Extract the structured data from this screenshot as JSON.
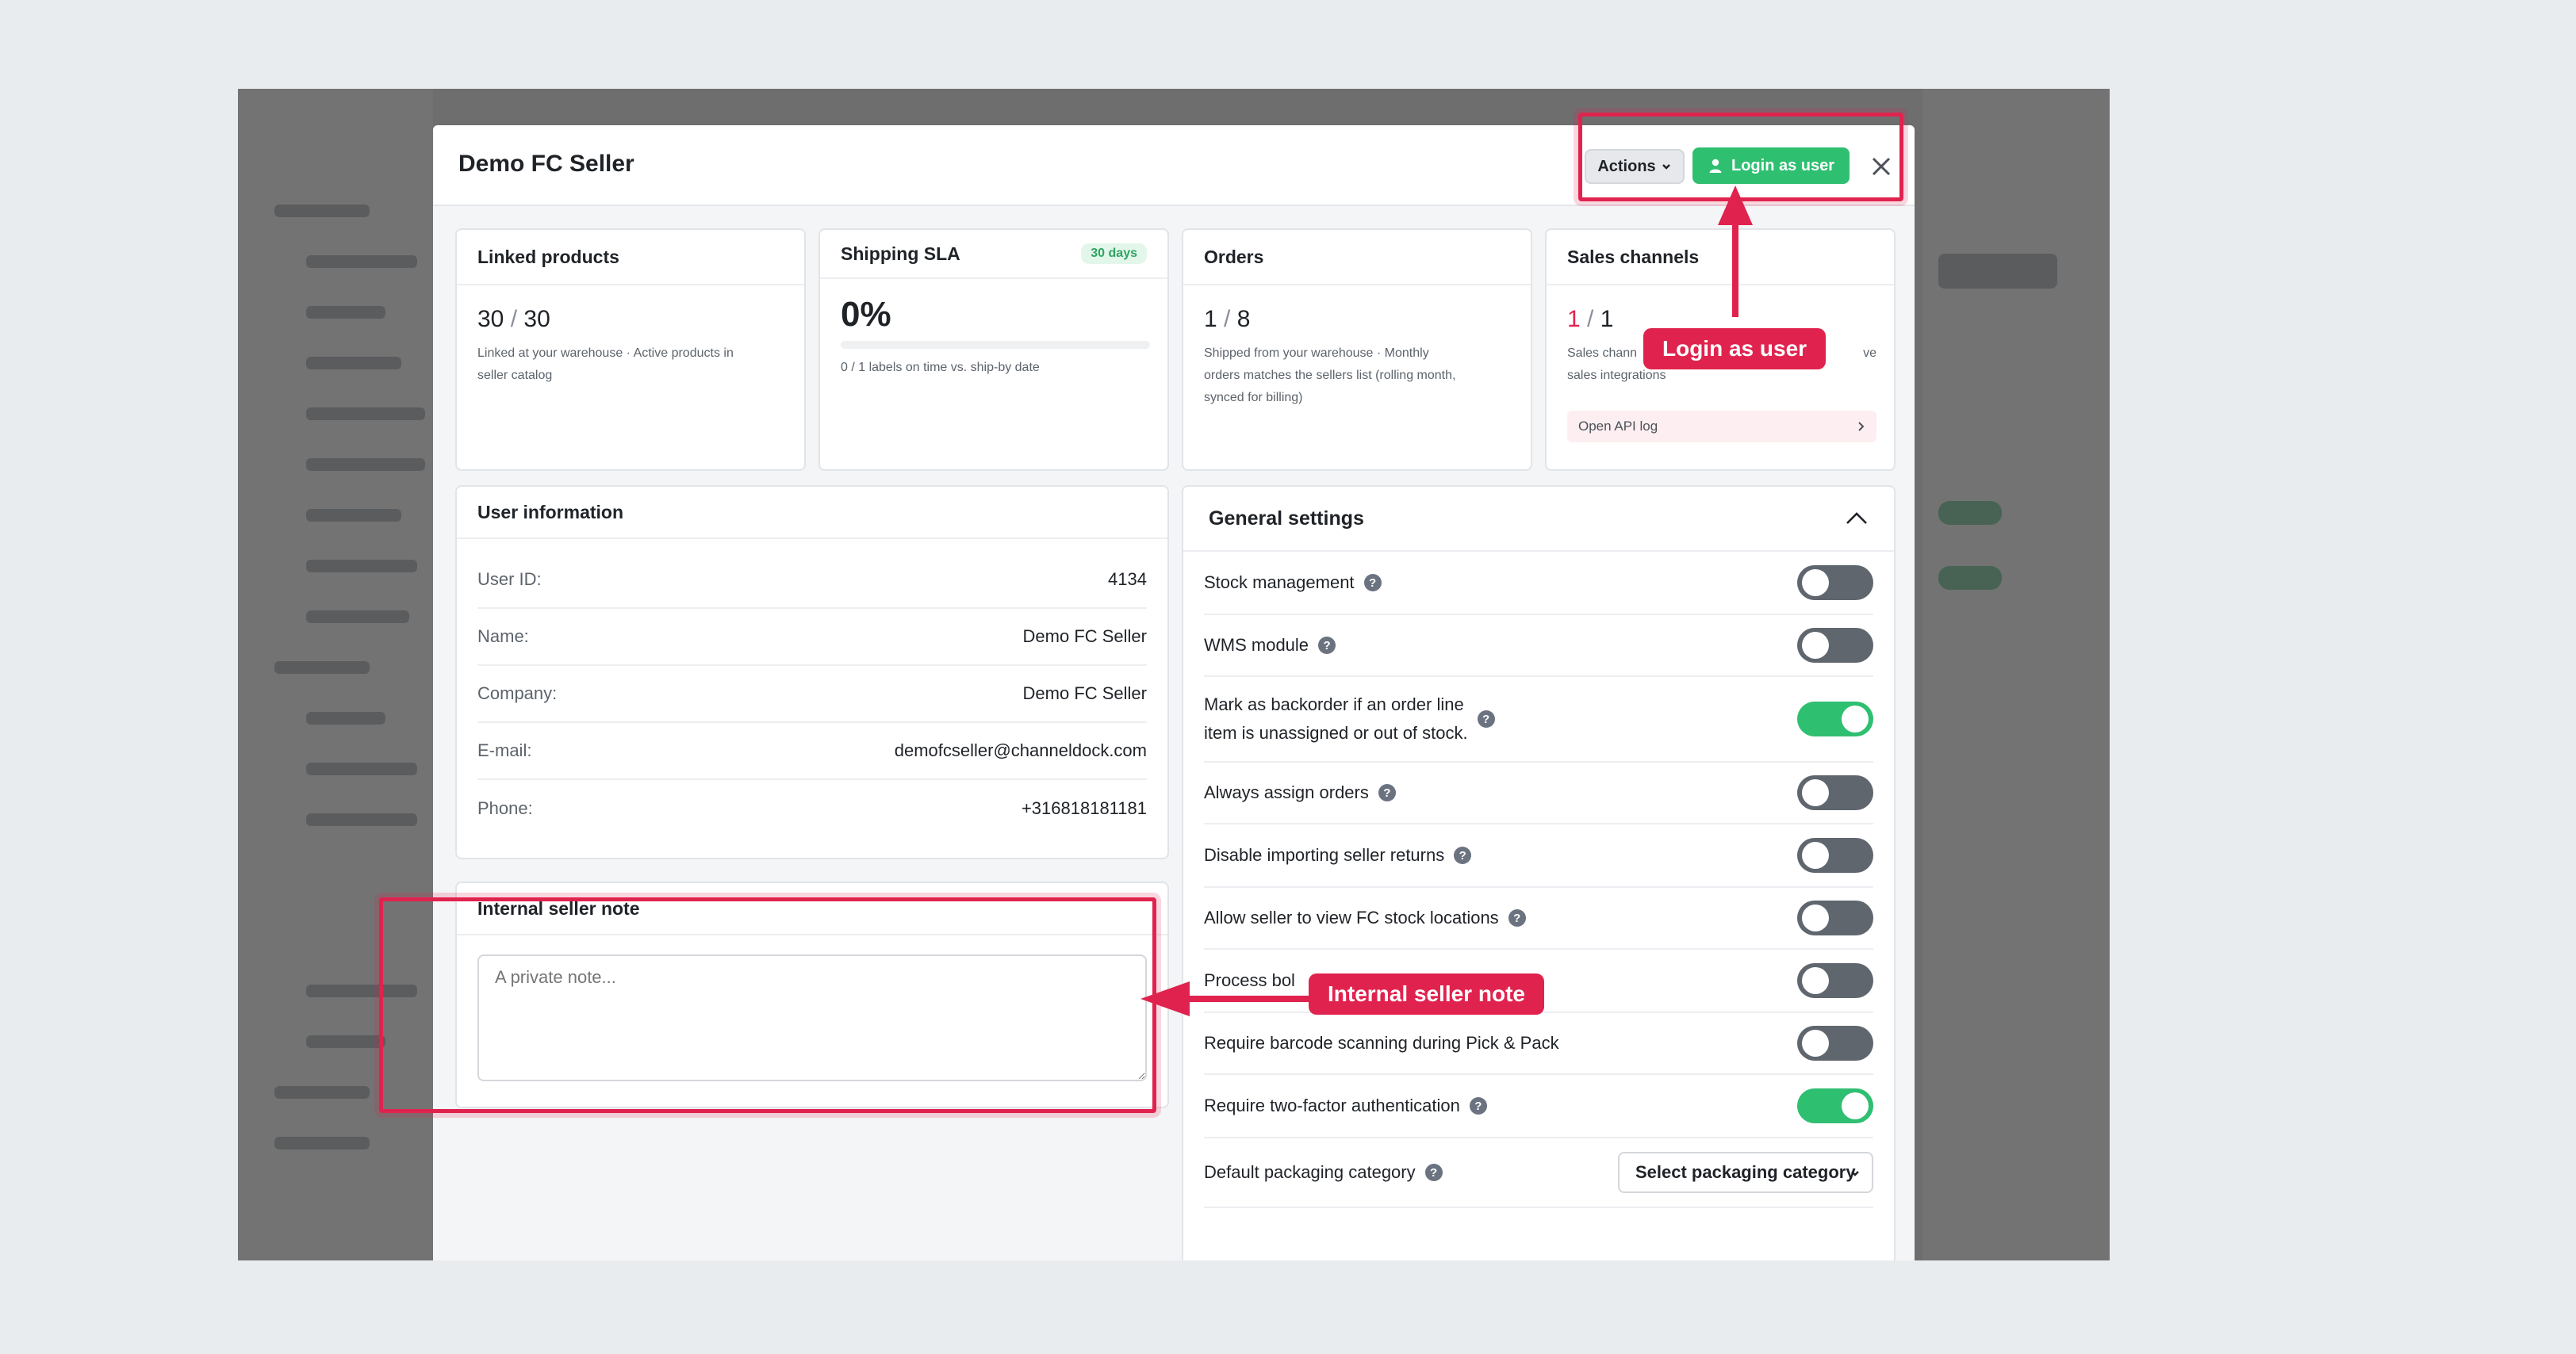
{
  "modal": {
    "title": "Demo FC Seller",
    "actions_label": "Actions",
    "login_label": "Login as user"
  },
  "stats": {
    "linked_products": {
      "title": "Linked products",
      "value_main": "30",
      "value_sep": " / ",
      "value_total": "30",
      "desc_line1": "Linked at your warehouse · Active products in",
      "desc_line2": "seller catalog"
    },
    "shipping_sla": {
      "title": "Shipping SLA",
      "badge": "30 days",
      "value": "0%",
      "progress": 0,
      "desc": "0 / 1 labels on time vs. ship-by date"
    },
    "orders": {
      "title": "Orders",
      "value_main": "1",
      "value_sep": " / ",
      "value_total": "8",
      "desc_line1": "Shipped from your warehouse · Monthly",
      "desc_line2": "orders matches the sellers list (rolling month,",
      "desc_line3": "synced for billing)"
    },
    "sales_channels": {
      "title": "Sales channels",
      "value_main": "1",
      "value_sep": " / ",
      "value_total": "1",
      "desc_line1": "Sales chann",
      "desc_line1_tail": "ve",
      "desc_line2": "sales integrations",
      "api_log_label": "Open API log"
    }
  },
  "user_info": {
    "title": "User information",
    "rows": [
      {
        "label": "User ID:",
        "value": "4134"
      },
      {
        "label": "Name:",
        "value": "Demo FC Seller"
      },
      {
        "label": "Company:",
        "value": "Demo FC Seller"
      },
      {
        "label": "E-mail:",
        "value": "demofcseller@channeldock.com"
      },
      {
        "label": "Phone:",
        "value": "+316818181181"
      }
    ]
  },
  "note": {
    "title": "Internal seller note",
    "placeholder": "A private note..."
  },
  "settings": {
    "title": "General settings",
    "rows": [
      {
        "label": "Stock management",
        "on": false
      },
      {
        "label": "WMS module",
        "on": false
      },
      {
        "label_line1": "Mark as backorder if an order line",
        "label_line2": "item is unassigned or out of stock.",
        "on": true
      },
      {
        "label": "Always assign orders",
        "on": false
      },
      {
        "label": "Disable importing seller returns",
        "on": false
      },
      {
        "label": "Allow seller to view FC stock locations",
        "on": false
      },
      {
        "label": "Process bol",
        "on": false
      },
      {
        "label": "Require barcode scanning during Pick & Pack",
        "on": false
      },
      {
        "label": "Require two-factor authentication",
        "on": true
      }
    ],
    "packaging_label": "Default packaging category",
    "packaging_select": "Select packaging category"
  },
  "annotations": {
    "login_callout": "Login as user",
    "note_callout": "Internal seller note"
  },
  "colors": {
    "accent_green": "#2fbf71",
    "annotation_red": "#e0234e",
    "value_red": "#e0234e"
  }
}
